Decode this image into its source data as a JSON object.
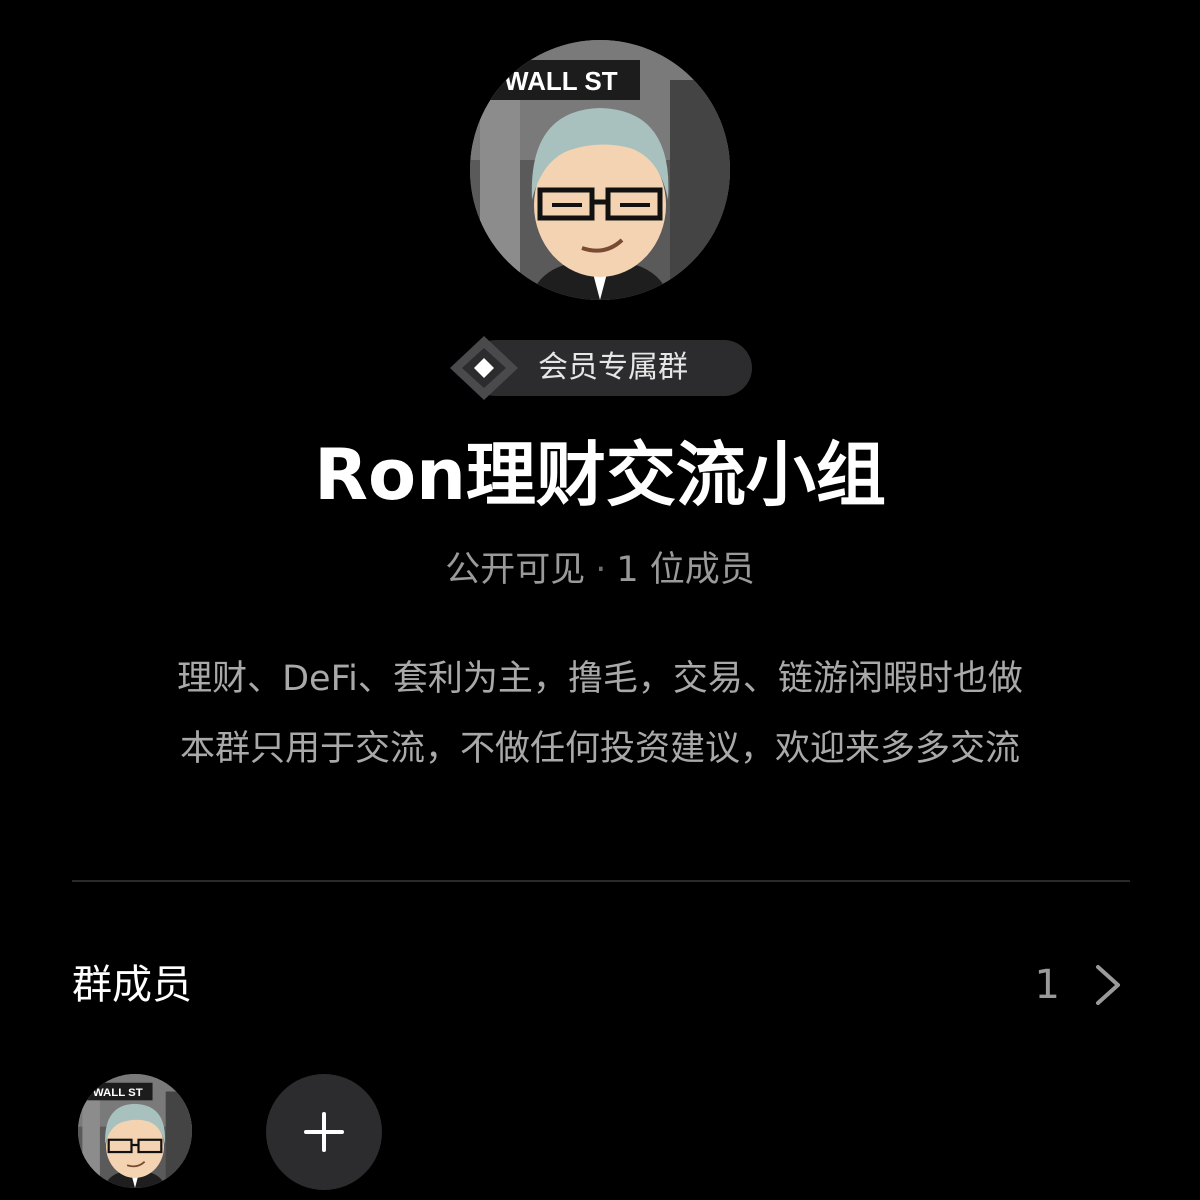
{
  "group": {
    "badge_label": "会员专属群",
    "title": "Ron理财交流小组",
    "visibility": "公开可见",
    "meta_separator": "·",
    "member_count_text": "1 位成员",
    "description_lines": [
      "理财、DeFi、套利为主，撸毛，交易、链游闲暇时也做",
      "本群只用于交流，不做任何投资建议，欢迎来多多交流"
    ],
    "avatar_sign_text": "WALL ST"
  },
  "members": {
    "label": "群成员",
    "count": "1"
  },
  "icons": {
    "badge": "diamond-icon",
    "chevron": "chevron-right-icon",
    "add": "plus-icon"
  },
  "colors": {
    "background": "#000000",
    "pill": "#2c2c2e",
    "secondary_text": "#9a9a9a"
  }
}
